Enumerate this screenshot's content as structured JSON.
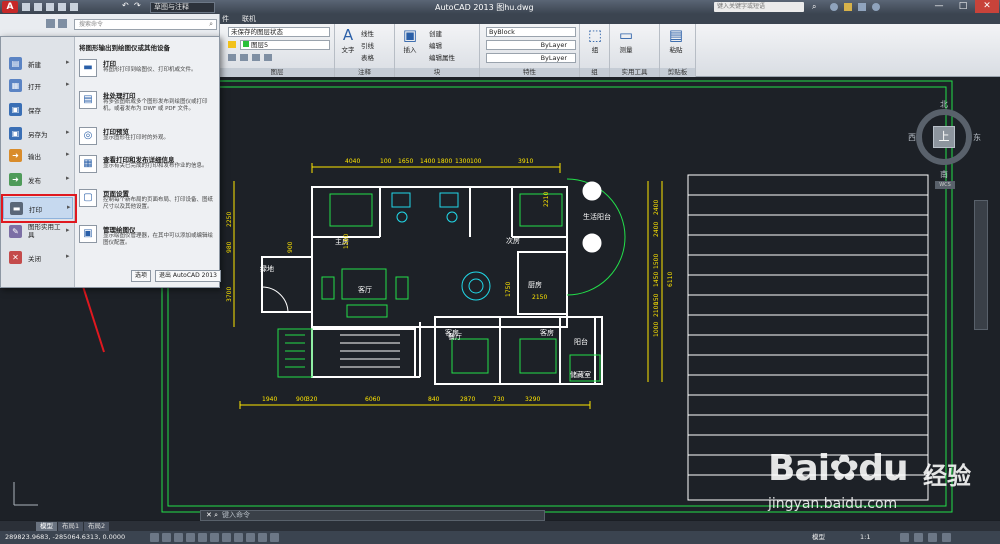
{
  "titlebar": {
    "workspace": "草图与注释",
    "window_title": "AutoCAD 2013    图hu.dwg",
    "search_placeholder": "键入关键字或短语",
    "min": "—",
    "max": "□",
    "close": "✕"
  },
  "menutabs": [
    "件",
    "联机"
  ],
  "ribbon": {
    "layer_state": "未保存的图层状态",
    "layer_current": "图层5",
    "panels": {
      "layer": "图层",
      "annotation": "注释",
      "block": "块",
      "properties": "特性",
      "group": "组",
      "utilities": "实用工具",
      "clipboard": "剪贴板"
    },
    "text_btn": "文字",
    "linear": "线性",
    "leader": "引线",
    "table": "表格",
    "insert": "插入",
    "create": "创建",
    "edit": "编辑",
    "edit_attr": "编辑属性",
    "group_btn": "组",
    "measure": "测量",
    "paste": "粘贴",
    "byblock": "ByBlock",
    "bylayer1": "ByLayer",
    "bylayer2": "ByLayer"
  },
  "appmenu": {
    "search_placeholder": "搜索命令",
    "left_items": [
      {
        "label": "新建",
        "color": "#5b84c4",
        "glyph": "▤"
      },
      {
        "label": "打开",
        "color": "#5b84c4",
        "glyph": "▦"
      },
      {
        "label": "保存",
        "color": "#3a6fb5",
        "glyph": "▣"
      },
      {
        "label": "另存为",
        "color": "#3a6fb5",
        "glyph": "▣"
      },
      {
        "label": "输出",
        "color": "#d98c2b",
        "glyph": "➜"
      },
      {
        "label": "发布",
        "color": "#4f9b5a",
        "glyph": "➜"
      },
      {
        "label": "打印",
        "color": "#5a6778",
        "glyph": "▬"
      },
      {
        "label": "图形实用工具",
        "color": "#7c6fa5",
        "glyph": "✎"
      },
      {
        "label": "关闭",
        "color": "#c44b4b",
        "glyph": "✕"
      }
    ],
    "header": "将图形输出到绘图仪或其他设备",
    "right_items": [
      {
        "title": "打印",
        "desc": "将图形打印到绘图仪、打印机或文件。",
        "glyph": "▬"
      },
      {
        "title": "批处理打印",
        "desc": "将多张图纸或多个图形发布到绘图仪或打印机，或者发布为 DWF 或 PDF 文件。",
        "glyph": "▤"
      },
      {
        "title": "打印预览",
        "desc": "显示图形在打印时的外观。",
        "glyph": "◎"
      },
      {
        "title": "查看打印和发布详细信息",
        "desc": "显示有关已完成的打印和发布作业的信息。",
        "glyph": "▦"
      },
      {
        "title": "页面设置",
        "desc": "控制每个新布局的页面布局、打印设备、图纸尺寸以及其他设置。",
        "glyph": "▢"
      },
      {
        "title": "管理绘图仪",
        "desc": "显示绘图仪管理器，在其中可以添加或编辑绘图仪配置。",
        "glyph": "▣"
      }
    ],
    "options_btn": "选项",
    "exit_btn": "退出 AutoCAD 2013"
  },
  "viewcube": {
    "north": "北",
    "south": "南",
    "east": "东",
    "west": "西",
    "top": "上",
    "wcs": "WCS"
  },
  "cmd_placeholder": "键入命令",
  "layout_tabs": [
    "模型",
    "布局1",
    "布局2"
  ],
  "status": {
    "coords": "289823.9683, -285064.6313, 0.0000",
    "model": "模型",
    "scale": "1:1"
  },
  "plan": {
    "dims_top": [
      "4040",
      "100",
      "1650",
      "1400",
      "1800",
      "1300",
      "100",
      "3910"
    ],
    "dims_bottom": [
      "1940",
      "900",
      "320",
      "6060",
      "840",
      "2870",
      "730",
      "3290"
    ],
    "dims_left": [
      "2250",
      "980",
      "3700"
    ],
    "dims_right": [
      "2400",
      "2400",
      "1500",
      "1450",
      "150",
      "2100",
      "1000",
      "6110"
    ],
    "rooms": {
      "master": "主房",
      "second": "次房",
      "balcony_life": "生活阳台",
      "garden": "绿地",
      "living": "客厅",
      "dining": "餐厅",
      "kitchen": "厨房",
      "guest1": "客房",
      "guest2": "客房",
      "balcony": "阳台",
      "storage": "储藏室"
    },
    "inner": {
      "d1100": "1100",
      "d900": "900",
      "d2150": "2150",
      "d2210": "2210",
      "d1750": "1750"
    }
  },
  "watermark": {
    "brand": "Bai",
    "brand2": "du",
    "jy": "经验",
    "url": "jingyan.baidu.com"
  },
  "colors": {
    "accent": "#e0181f",
    "dim": "#ffe600",
    "wall": "#ffffff",
    "green": "#22e04a",
    "cyan": "#21d8e8"
  }
}
